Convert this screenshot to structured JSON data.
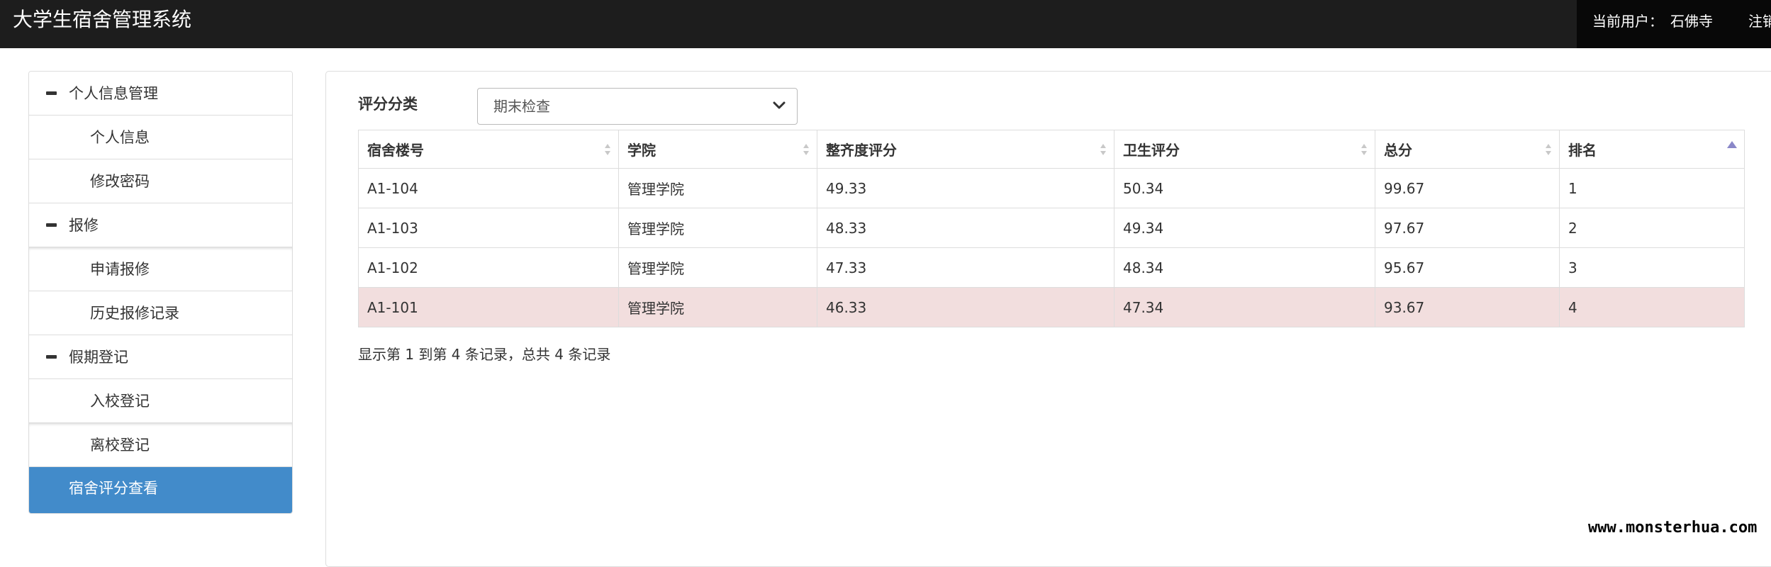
{
  "header": {
    "title": "大学生宿舍管理系统",
    "current_user_label": "当前用户：",
    "user_name": "石佛寺",
    "logout_label": "注销"
  },
  "sidebar": {
    "items": [
      {
        "label": "个人信息管理",
        "type": "group",
        "icon": "minus-icon"
      },
      {
        "label": "个人信息",
        "type": "sub"
      },
      {
        "label": "修改密码",
        "type": "sub"
      },
      {
        "label": "报修",
        "type": "group",
        "icon": "minus-icon"
      },
      {
        "label": "申请报修",
        "type": "sub"
      },
      {
        "label": "历史报修记录",
        "type": "sub"
      },
      {
        "label": "假期登记",
        "type": "group",
        "icon": "minus-icon"
      },
      {
        "label": "入校登记",
        "type": "sub"
      },
      {
        "label": "离校登记",
        "type": "sub"
      },
      {
        "label": "宿舍评分查看",
        "type": "active"
      }
    ]
  },
  "filter": {
    "label": "评分分类",
    "selected": "期末检查"
  },
  "table": {
    "columns": [
      "宿舍楼号",
      "学院",
      "整齐度评分",
      "卫生评分",
      "总分",
      "排名"
    ],
    "sorted_column": "排名",
    "rows": [
      [
        "A1-104",
        "管理学院",
        "49.33",
        "50.34",
        "99.67",
        "1"
      ],
      [
        "A1-103",
        "管理学院",
        "48.33",
        "49.34",
        "97.67",
        "2"
      ],
      [
        "A1-102",
        "管理学院",
        "47.33",
        "48.34",
        "95.67",
        "3"
      ],
      [
        "A1-101",
        "管理学院",
        "46.33",
        "47.34",
        "93.67",
        "4"
      ]
    ]
  },
  "pagination": {
    "info": "显示第 1 到第 4 条记录，总共 4 条记录"
  },
  "watermark": "www.monsterhua.com",
  "colors": {
    "topbar": "#1d1d1d",
    "active_menu": "#428bca",
    "highlight_row": "#f2dede"
  }
}
